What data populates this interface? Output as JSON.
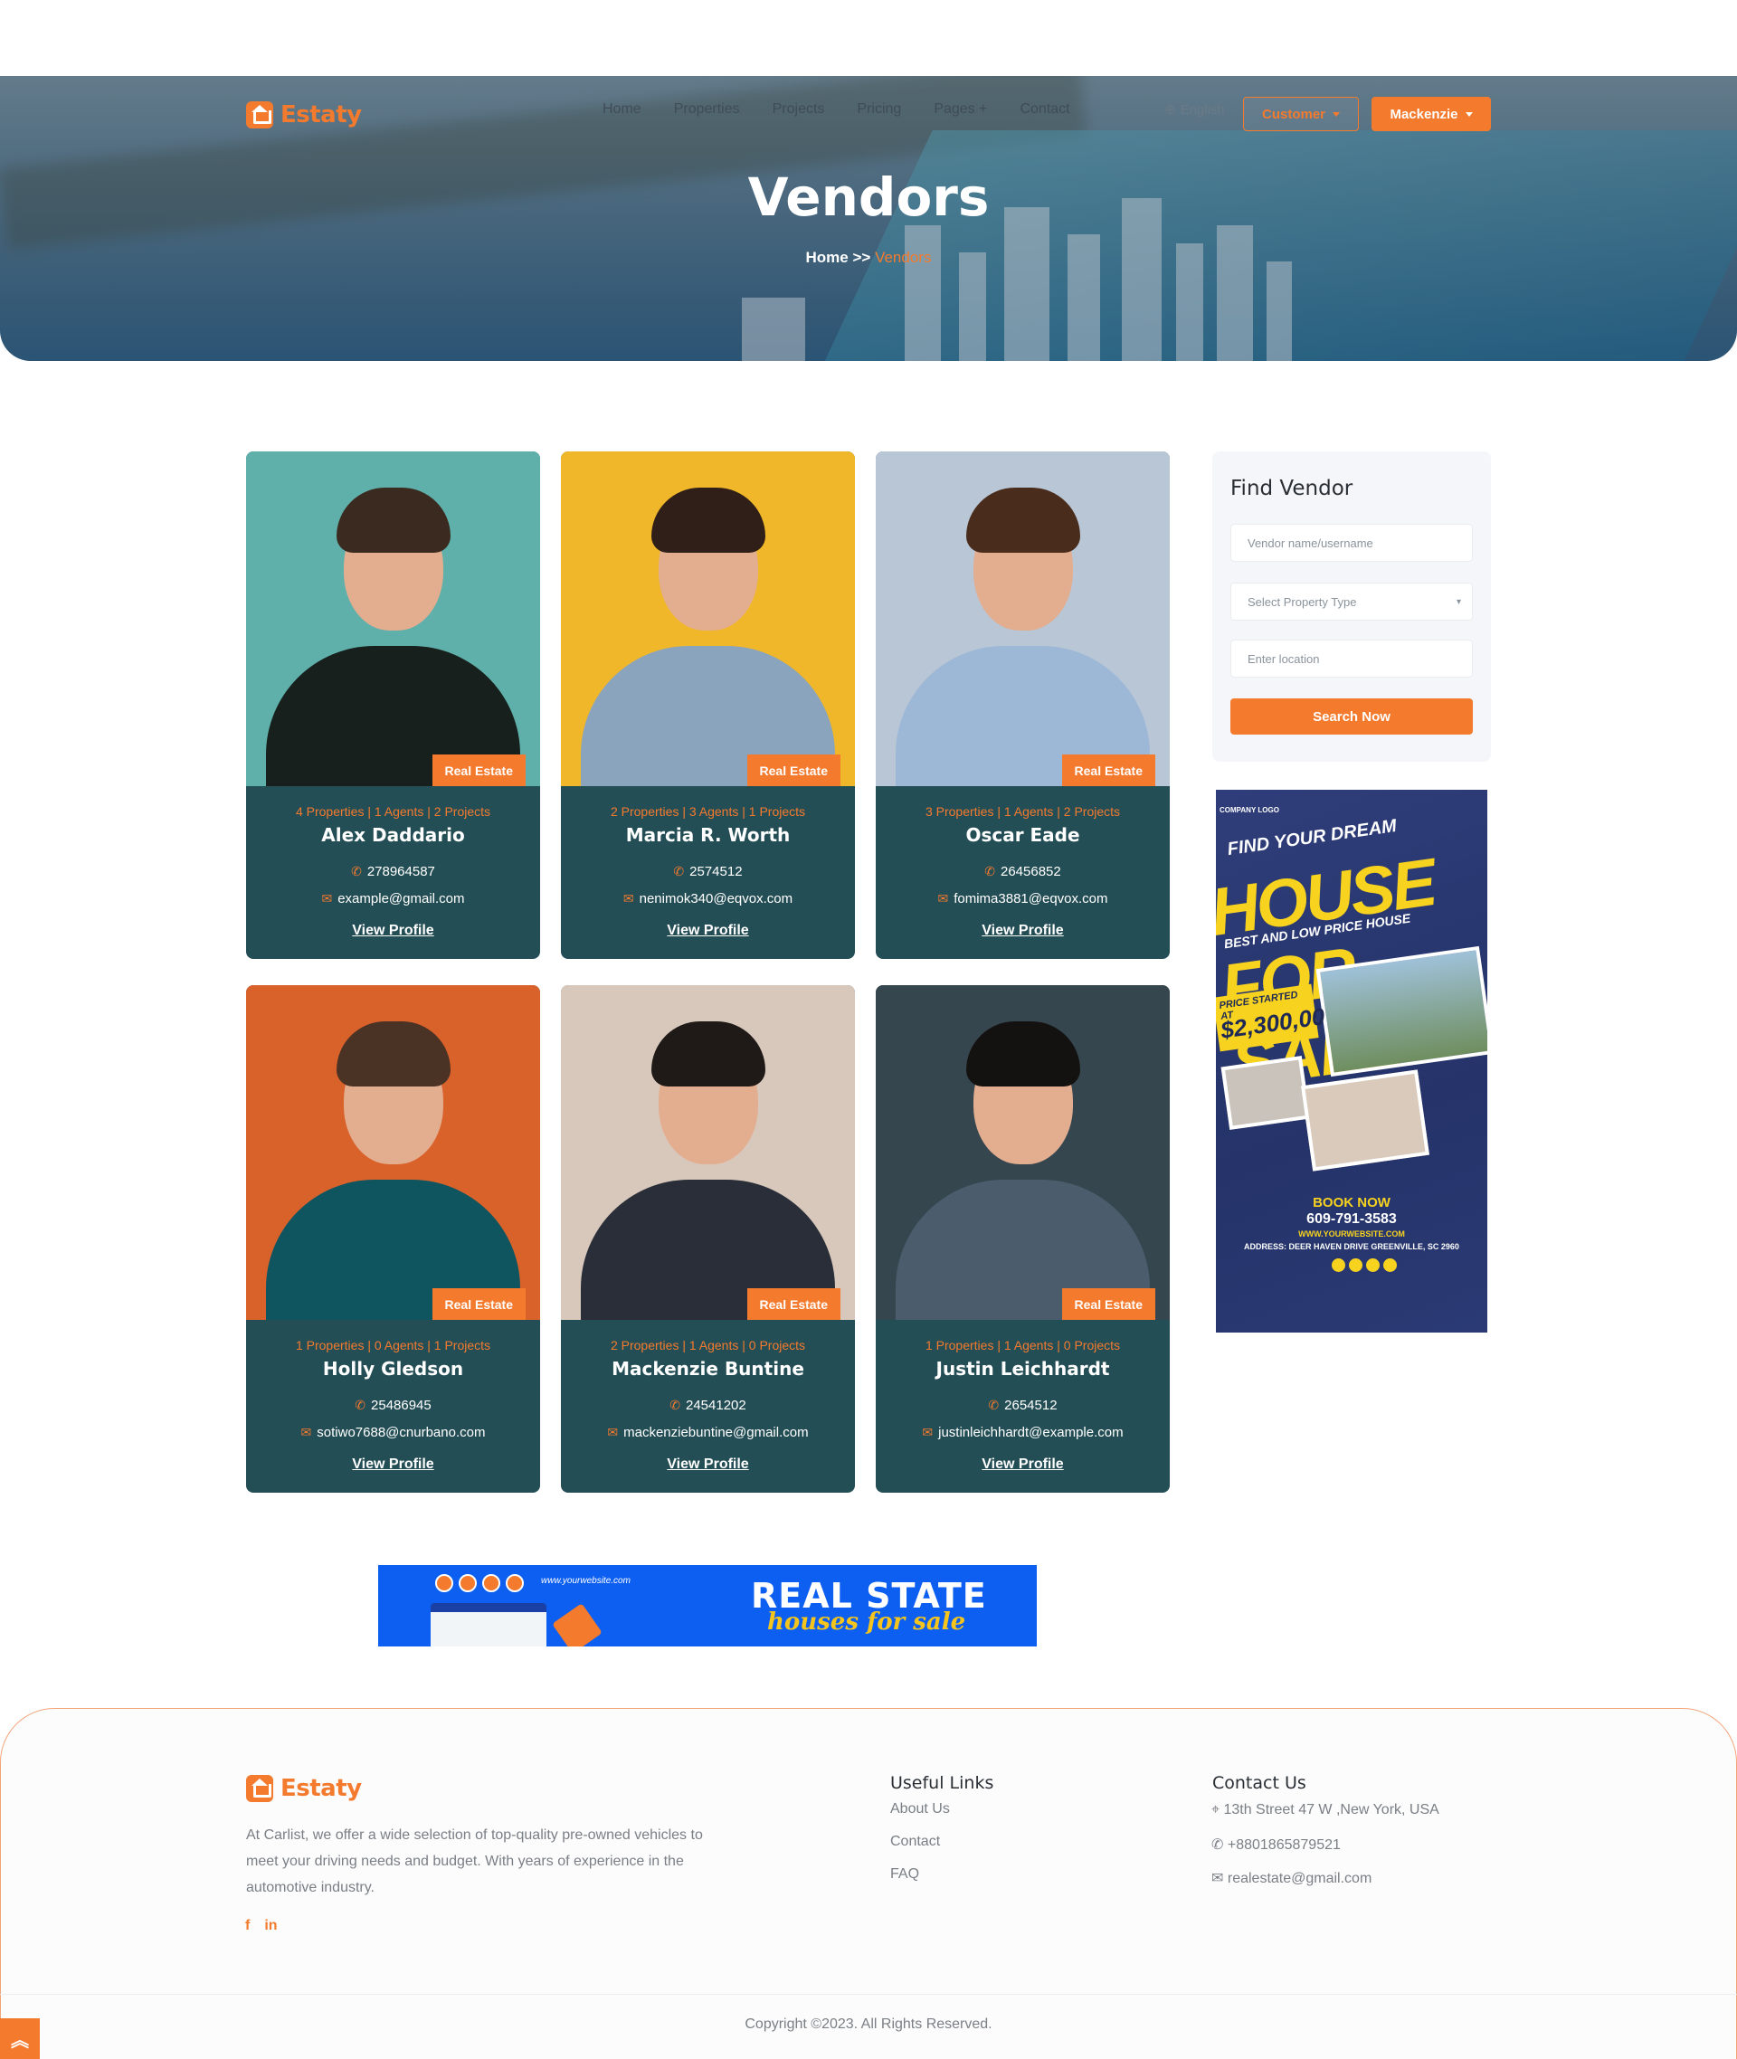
{
  "brand": {
    "name": "Estaty"
  },
  "nav": {
    "items": [
      "Home",
      "Properties",
      "Projects",
      "Pricing",
      "Pages +",
      "Contact"
    ],
    "language": "English",
    "customer_button": "Customer",
    "user_button": "Mackenzie"
  },
  "hero": {
    "title": "Vendors",
    "breadcrumb_home": "Home",
    "breadcrumb_sep": ">>",
    "breadcrumb_current": "Vendors"
  },
  "vendors": [
    {
      "tag": "Real Estate",
      "stats": "4 Properties | 1 Agents | 2 Projects",
      "name": "Alex Daddario",
      "phone": "278964587",
      "email": "example@gmail.com",
      "view": "View Profile",
      "bg": "#5fb0aa",
      "shirt": "#17201c",
      "hair": "#3b2a1f"
    },
    {
      "tag": "Real Estate",
      "stats": "2 Properties | 3 Agents | 1 Projects",
      "name": "Marcia R. Worth",
      "phone": "2574512",
      "email": "nenimok340@eqvox.com",
      "view": "View Profile",
      "bg": "#f0b72a",
      "shirt": "#8aa4bd",
      "hair": "#2f1f18"
    },
    {
      "tag": "Real Estate",
      "stats": "3 Properties | 1 Agents | 2 Projects",
      "name": "Oscar Eade",
      "phone": "26456852",
      "email": "fomima3881@eqvox.com",
      "view": "View Profile",
      "bg": "#b9c6d6",
      "shirt": "#9db7d6",
      "hair": "#4a2c1c"
    },
    {
      "tag": "Real Estate",
      "stats": "1 Properties | 0 Agents | 1 Projects",
      "name": "Holly Gledson",
      "phone": "25486945",
      "email": "sotiwo7688@cnurbano.com",
      "view": "View Profile",
      "bg": "#d9622b",
      "shirt": "#0f5560",
      "hair": "#4a3224"
    },
    {
      "tag": "Real Estate",
      "stats": "2 Properties | 1 Agents | 0 Projects",
      "name": "Mackenzie Buntine",
      "phone": "24541202",
      "email": "mackenziebuntine@gmail.com",
      "view": "View Profile",
      "bg": "#d8c8bb",
      "shirt": "#2a2e38",
      "hair": "#1f1a17"
    },
    {
      "tag": "Real Estate",
      "stats": "1 Properties | 1 Agents | 0 Projects",
      "name": "Justin Leichhardt",
      "phone": "2654512",
      "email": "justinleichhardt@example.com",
      "view": "View Profile",
      "bg": "#36464f",
      "shirt": "#4b5c6c",
      "hair": "#141210"
    }
  ],
  "finder": {
    "title": "Find Vendor",
    "name_placeholder": "Vendor name/username",
    "type_placeholder": "Select Property Type",
    "location_placeholder": "Enter location",
    "search_label": "Search Now"
  },
  "ad": {
    "company": "COMPANY LOGO",
    "line1": "FIND YOUR DREAM",
    "line2": "HOUSE FOR SALE",
    "line3": "BEST AND LOW PRICE HOUSE",
    "price_label": "PRICE STARTED AT",
    "price": "$2,300,00",
    "book": "BOOK NOW",
    "phone": "609-791-3583",
    "web": "WWW.YOURWEBSITE.COM",
    "address": "ADDRESS: DEER HAVEN DRIVE GREENVILLE, SC 2960"
  },
  "banner": {
    "web": "www.yourwebsite.com",
    "title": "REAL STATE",
    "subtitle": "houses for sale",
    "tag": "%"
  },
  "footer": {
    "about": "At Carlist, we offer a wide selection of top-quality pre-owned vehicles to meet your driving needs and budget. With years of experience in the automotive industry.",
    "social_f": "f",
    "social_in": "in",
    "useful_title": "Useful Links",
    "links": [
      "About Us",
      "Contact",
      "FAQ"
    ],
    "contact_title": "Contact Us",
    "address": "13th Street 47 W ,New York, USA",
    "phone": "+8801865879521",
    "email": "realestate@gmail.com",
    "copyright": "Copyright ©2023. All Rights Reserved."
  }
}
